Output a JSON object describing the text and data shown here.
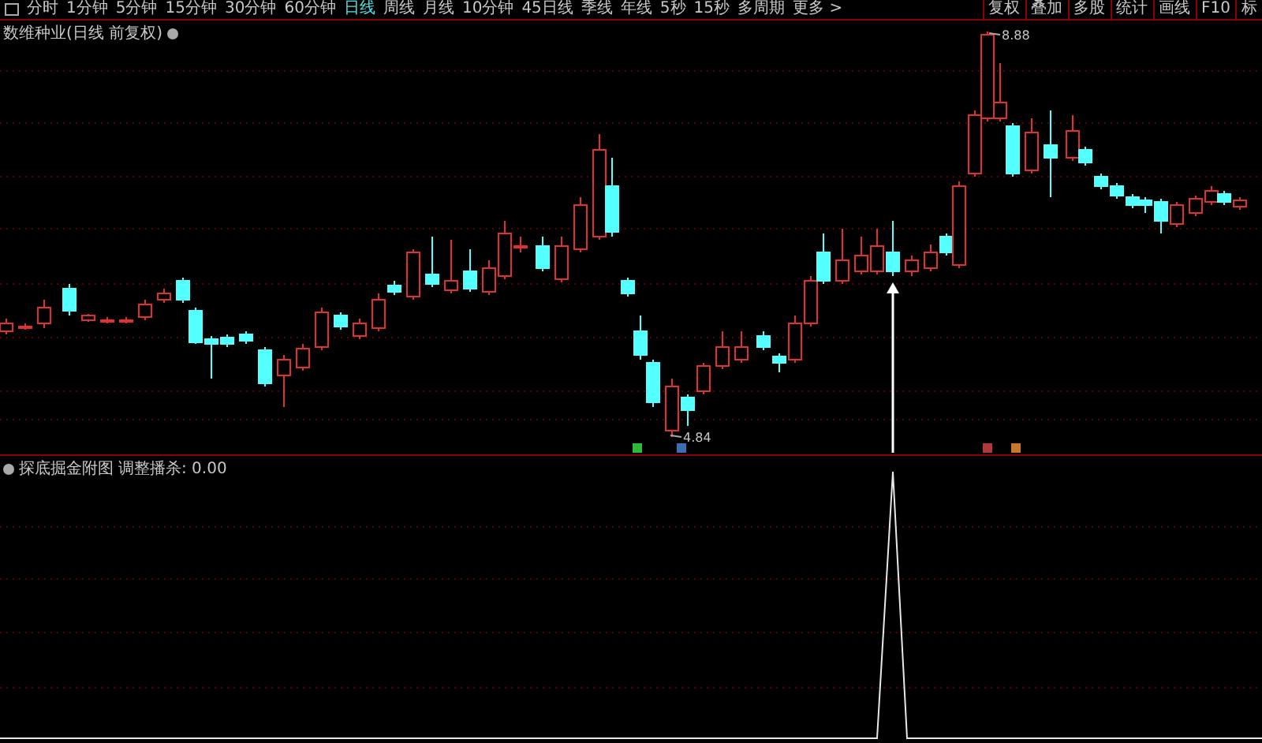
{
  "toolbar": {
    "tabs": [
      {
        "label": "分时",
        "selected": false
      },
      {
        "label": "1分钟",
        "selected": false
      },
      {
        "label": "5分钟",
        "selected": false
      },
      {
        "label": "15分钟",
        "selected": false
      },
      {
        "label": "30分钟",
        "selected": false
      },
      {
        "label": "60分钟",
        "selected": false
      },
      {
        "label": "日线",
        "selected": true
      },
      {
        "label": "周线",
        "selected": false
      },
      {
        "label": "月线",
        "selected": false
      },
      {
        "label": "10分钟",
        "selected": false
      },
      {
        "label": "45日线",
        "selected": false
      },
      {
        "label": "季线",
        "selected": false
      },
      {
        "label": "年线",
        "selected": false
      },
      {
        "label": "5秒",
        "selected": false
      },
      {
        "label": "15秒",
        "selected": false
      },
      {
        "label": "多周期",
        "selected": false
      },
      {
        "label": "更多 >",
        "selected": false
      }
    ],
    "buttons": [
      "复权",
      "叠加",
      "多股",
      "统计",
      "画线",
      "F10",
      "标"
    ]
  },
  "chart": {
    "title": "数维种业(日线 前复权)",
    "high_label": "8.88",
    "low_label": "4.84",
    "markers": [
      {
        "color": "#2fb83a"
      },
      {
        "color": "#3a6fb0"
      },
      {
        "color": "#b03a3a"
      },
      {
        "color": "#c8782a"
      }
    ]
  },
  "indicator": {
    "title": "探底掘金附图",
    "reading": "调整播杀: 0.00"
  }
}
